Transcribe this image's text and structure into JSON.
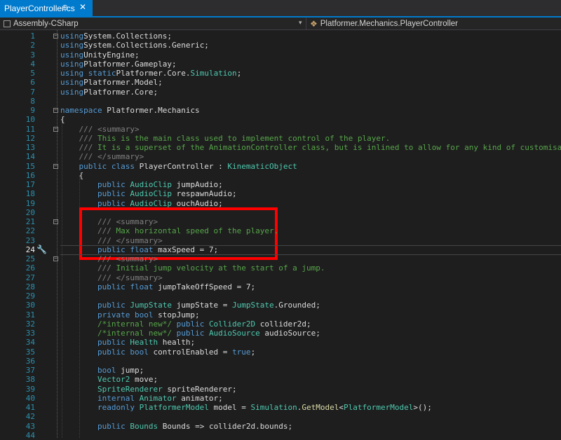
{
  "tab": {
    "title": "PlayerController.cs",
    "pin": "⊕",
    "close": "✕"
  },
  "navbar": {
    "project": "Assembly-CSharp",
    "member": "Platformer.Mechanics.PlayerController",
    "dropdown": "▾"
  },
  "lines": [
    {
      "n": "1",
      "segs": [
        [
          "k",
          "using"
        ],
        [
          "",
          "System.Collections;"
        ]
      ]
    },
    {
      "n": "2",
      "segs": [
        [
          "k",
          "using"
        ],
        [
          "",
          "System.Collections.Generic;"
        ]
      ]
    },
    {
      "n": "3",
      "segs": [
        [
          "k",
          "using"
        ],
        [
          "",
          "UnityEngine;"
        ]
      ]
    },
    {
      "n": "4",
      "segs": [
        [
          "k",
          "using"
        ],
        [
          "",
          "Platformer.Gameplay;"
        ]
      ]
    },
    {
      "n": "5",
      "segs": [
        [
          "k",
          "using static"
        ],
        [
          "",
          "Platformer.Core."
        ],
        [
          "t",
          "Simulation"
        ],
        [
          "",
          ";"
        ]
      ]
    },
    {
      "n": "6",
      "segs": [
        [
          "k",
          "using"
        ],
        [
          "",
          "Platformer.Model;"
        ]
      ]
    },
    {
      "n": "7",
      "segs": [
        [
          "k",
          "using"
        ],
        [
          "",
          "Platformer.Core;"
        ]
      ]
    },
    {
      "n": "8",
      "segs": []
    },
    {
      "n": "9",
      "segs": [
        [
          "k",
          "namespace"
        ],
        [
          "",
          " Platformer.Mechanics"
        ]
      ]
    },
    {
      "n": "10",
      "segs": [
        [
          "",
          "{"
        ]
      ]
    },
    {
      "n": "11",
      "segs": [
        [
          "g",
          "    ///"
        ],
        [
          "g",
          " <summary>"
        ]
      ]
    },
    {
      "n": "12",
      "segs": [
        [
          "g",
          "    ///"
        ],
        [
          "c",
          " This is the main class used to implement control of the player."
        ]
      ]
    },
    {
      "n": "13",
      "segs": [
        [
          "g",
          "    ///"
        ],
        [
          "c",
          " It is a superset of the AnimationController class, but is inlined to allow for any kind of customisation."
        ]
      ]
    },
    {
      "n": "14",
      "segs": [
        [
          "g",
          "    ///"
        ],
        [
          "g",
          " </summary>"
        ]
      ]
    },
    {
      "n": "15",
      "segs": [
        [
          "k",
          "    public class"
        ],
        [
          "",
          " PlayerController : "
        ],
        [
          "t",
          "KinematicObject"
        ]
      ]
    },
    {
      "n": "16",
      "segs": [
        [
          "",
          "    {"
        ]
      ]
    },
    {
      "n": "17",
      "segs": [
        [
          "k",
          "        public"
        ],
        [
          "",
          " "
        ],
        [
          "t",
          "AudioClip"
        ],
        [
          "",
          " jumpAudio;"
        ]
      ]
    },
    {
      "n": "18",
      "segs": [
        [
          "k",
          "        public"
        ],
        [
          "",
          " "
        ],
        [
          "t",
          "AudioClip"
        ],
        [
          "",
          " respawnAudio;"
        ]
      ]
    },
    {
      "n": "19",
      "segs": [
        [
          "k",
          "        public"
        ],
        [
          "",
          " "
        ],
        [
          "t",
          "AudioClip"
        ],
        [
          "",
          " ouchAudio;"
        ]
      ]
    },
    {
      "n": "20",
      "segs": []
    },
    {
      "n": "21",
      "segs": [
        [
          "g",
          "        ///"
        ],
        [
          "g",
          " <summary>"
        ]
      ]
    },
    {
      "n": "22",
      "segs": [
        [
          "g",
          "        ///"
        ],
        [
          "c",
          " Max horizontal speed of the player."
        ]
      ]
    },
    {
      "n": "23",
      "segs": [
        [
          "g",
          "        ///"
        ],
        [
          "g",
          " </summary>"
        ]
      ]
    },
    {
      "n": "24",
      "segs": [
        [
          "k",
          "        public float"
        ],
        [
          "",
          " maxSpeed = 7;"
        ]
      ]
    },
    {
      "n": "25",
      "segs": [
        [
          "g",
          "        ///"
        ],
        [
          "g",
          " <summary>"
        ]
      ]
    },
    {
      "n": "26",
      "segs": [
        [
          "g",
          "        ///"
        ],
        [
          "c",
          " Initial jump velocity at the start of a jump."
        ]
      ]
    },
    {
      "n": "27",
      "segs": [
        [
          "g",
          "        ///"
        ],
        [
          "g",
          " </summary>"
        ]
      ]
    },
    {
      "n": "28",
      "segs": [
        [
          "k",
          "        public float"
        ],
        [
          "",
          " jumpTakeOffSpeed = 7;"
        ]
      ]
    },
    {
      "n": "29",
      "segs": []
    },
    {
      "n": "30",
      "segs": [
        [
          "k",
          "        public"
        ],
        [
          "",
          " "
        ],
        [
          "t",
          "JumpState"
        ],
        [
          "",
          " jumpState = "
        ],
        [
          "t",
          "JumpState"
        ],
        [
          "",
          ".Grounded;"
        ]
      ]
    },
    {
      "n": "31",
      "segs": [
        [
          "k",
          "        private bool"
        ],
        [
          "",
          " stopJump;"
        ]
      ]
    },
    {
      "n": "32",
      "segs": [
        [
          "c",
          "        /*internal new*/"
        ],
        [
          "k",
          " public"
        ],
        [
          "",
          " "
        ],
        [
          "t",
          "Collider2D"
        ],
        [
          "",
          " collider2d;"
        ]
      ]
    },
    {
      "n": "33",
      "segs": [
        [
          "c",
          "        /*internal new*/"
        ],
        [
          "k",
          " public"
        ],
        [
          "",
          " "
        ],
        [
          "t",
          "AudioSource"
        ],
        [
          "",
          " audioSource;"
        ]
      ]
    },
    {
      "n": "34",
      "segs": [
        [
          "k",
          "        public"
        ],
        [
          "",
          " "
        ],
        [
          "t",
          "Health"
        ],
        [
          "",
          " health;"
        ]
      ]
    },
    {
      "n": "35",
      "segs": [
        [
          "k",
          "        public bool"
        ],
        [
          "",
          " controlEnabled = "
        ],
        [
          "k",
          "true"
        ],
        [
          "",
          ";"
        ]
      ]
    },
    {
      "n": "36",
      "segs": []
    },
    {
      "n": "37",
      "segs": [
        [
          "k",
          "        bool"
        ],
        [
          "",
          " jump;"
        ]
      ]
    },
    {
      "n": "38",
      "segs": [
        [
          "t",
          "        Vector2"
        ],
        [
          "",
          " move;"
        ]
      ]
    },
    {
      "n": "39",
      "segs": [
        [
          "t",
          "        SpriteRenderer"
        ],
        [
          "",
          " spriteRenderer;"
        ]
      ]
    },
    {
      "n": "40",
      "segs": [
        [
          "k",
          "        internal"
        ],
        [
          "",
          " "
        ],
        [
          "t",
          "Animator"
        ],
        [
          "",
          " animator;"
        ]
      ]
    },
    {
      "n": "41",
      "segs": [
        [
          "k",
          "        readonly"
        ],
        [
          "",
          " "
        ],
        [
          "t",
          "PlatformerModel"
        ],
        [
          "",
          " model = "
        ],
        [
          "t",
          "Simulation"
        ],
        [
          "",
          "."
        ],
        [
          "m",
          "GetModel"
        ],
        [
          "",
          "<"
        ],
        [
          "t",
          "PlatformerModel"
        ],
        [
          "",
          ">();"
        ]
      ]
    },
    {
      "n": "42",
      "segs": []
    },
    {
      "n": "43",
      "segs": [
        [
          "k",
          "        public"
        ],
        [
          "",
          " "
        ],
        [
          "t",
          "Bounds"
        ],
        [
          "",
          " Bounds => collider2d.bounds;"
        ]
      ]
    },
    {
      "n": "44",
      "segs": []
    }
  ],
  "current_line": "24",
  "colors": {
    "keyword": "#569cd6",
    "type": "#4ec9b0",
    "comment": "#57a64a",
    "highlight": "#ff0000",
    "tab_accent": "#007acc"
  }
}
